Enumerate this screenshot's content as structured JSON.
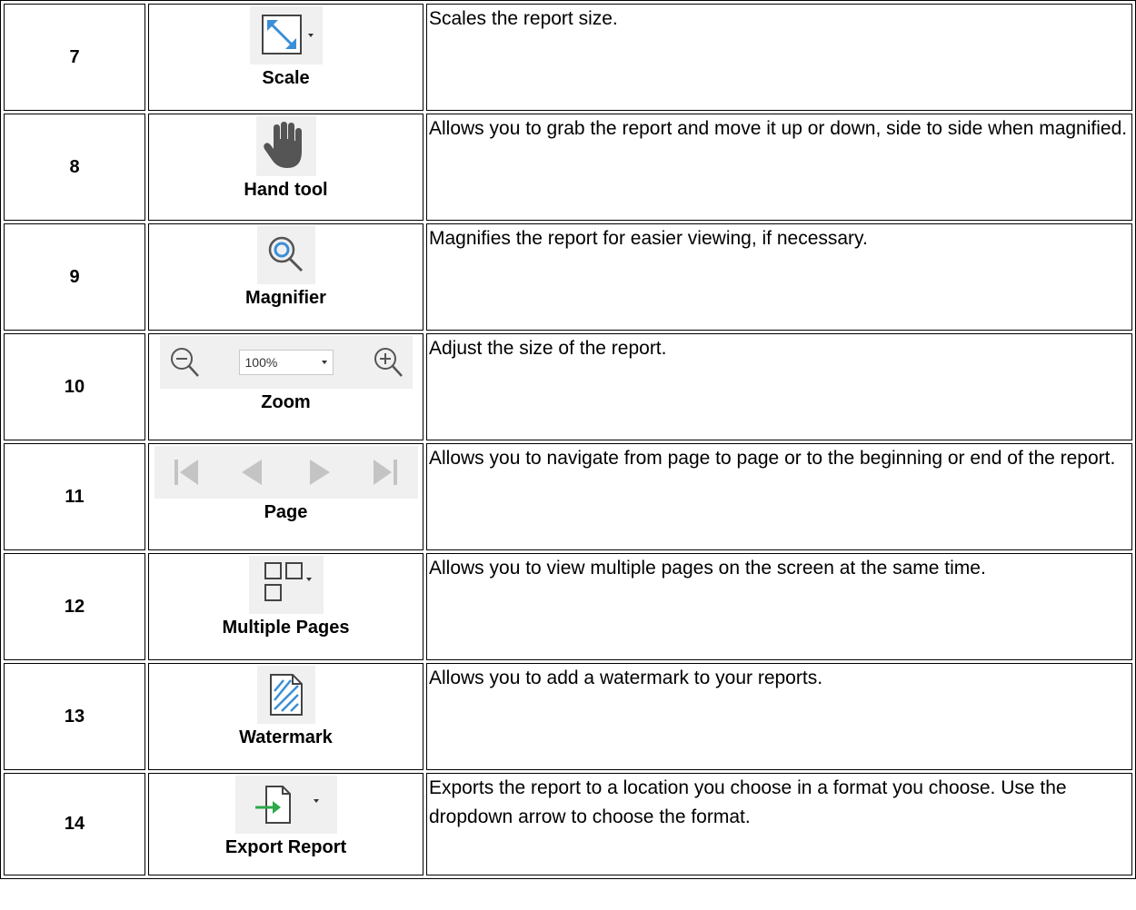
{
  "rows": [
    {
      "number": "7",
      "label": "Scale",
      "icon": "scale-icon",
      "description": "Scales the report size."
    },
    {
      "number": "8",
      "label": "Hand tool",
      "icon": "hand-icon",
      "description": "Allows you to grab the report and move it up or down, side to side when magnified."
    },
    {
      "number": "9",
      "label": "Magnifier",
      "icon": "magnifier-icon",
      "description": "Magnifies the report for easier viewing, if necessary."
    },
    {
      "number": "10",
      "label": "Zoom",
      "icon": "zoom-icons",
      "zoom_value": "100%",
      "description": "Adjust the size of the report."
    },
    {
      "number": "11",
      "label": "Page",
      "icon": "page-navigation-icons",
      "description": "Allows you to navigate from page to page or to the beginning or end of the report."
    },
    {
      "number": "12",
      "label": "Multiple Pages",
      "icon": "multiple-pages-icon",
      "description": "Allows you to view multiple pages on the screen at the same time."
    },
    {
      "number": "13",
      "label": "Watermark",
      "icon": "watermark-icon",
      "description": "Allows you to add a watermark to your reports."
    },
    {
      "number": "14",
      "label": "Export Report",
      "icon": "export-report-icon",
      "description": "Exports the report to a location you choose in a format you choose. Use the dropdown arrow to choose the format."
    }
  ],
  "colors": {
    "icon_bg": "#f0f0f0",
    "icon_blue": "#3b8fd6",
    "icon_gray": "#555555",
    "nav_gray": "#c4c4c4",
    "export_green": "#2ea84a"
  }
}
